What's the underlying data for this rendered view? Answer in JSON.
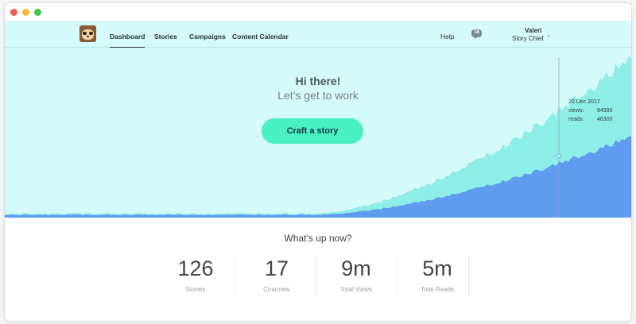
{
  "nav": {
    "items": [
      {
        "label": "Dashboard",
        "active": true
      },
      {
        "label": "Stories"
      },
      {
        "label": "Campaigns"
      },
      {
        "label": "Content Calendar"
      }
    ],
    "help_label": "Help",
    "notifications_count": "18",
    "notifications_icon": "chat-bubble-icon",
    "user": {
      "name": "Valeri",
      "org": "Story Chief"
    },
    "dropdown_icon": "chevron-down-icon"
  },
  "hero": {
    "title": "Hi there!",
    "subtitle": "Let’s get to work",
    "cta_label": "Craft a story",
    "tooltip": {
      "date": "20 Dec 2017",
      "views_label": "views:",
      "views_value": "94990",
      "reads_label": "reads:",
      "reads_value": "46300"
    }
  },
  "stats": {
    "title": "What’s up now?",
    "items": [
      {
        "value": "126",
        "label": "Stories"
      },
      {
        "value": "17",
        "label": "Channels"
      },
      {
        "value": "9m",
        "label": "Total Views"
      },
      {
        "value": "5m",
        "label": "Total Reads"
      }
    ]
  },
  "colors": {
    "accent": "#49f0c0",
    "nav_bg": "#d4fafa",
    "views_area": "#8deee7",
    "reads_area": "#5f9cf0"
  }
}
